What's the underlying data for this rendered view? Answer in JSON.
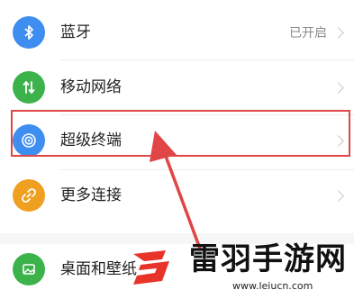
{
  "settings": {
    "items": [
      {
        "label": "蓝牙",
        "value": "已开启",
        "icon": "bluetooth-icon",
        "color": "#3d8ef0"
      },
      {
        "label": "移动网络",
        "icon": "mobile-data-icon",
        "color": "#3cb24b"
      },
      {
        "label": "超级终端",
        "icon": "super-terminal-icon",
        "color": "#3d8ef0"
      },
      {
        "label": "更多连接",
        "icon": "link-icon",
        "color": "#f0a020"
      },
      {
        "label": "桌面和壁纸",
        "icon": "wallpaper-icon",
        "color": "#3cb24b"
      }
    ]
  },
  "watermark": {
    "title": "雷羽手游网",
    "url": "www.leiucn.com",
    "brand_color": "#e8332b"
  }
}
